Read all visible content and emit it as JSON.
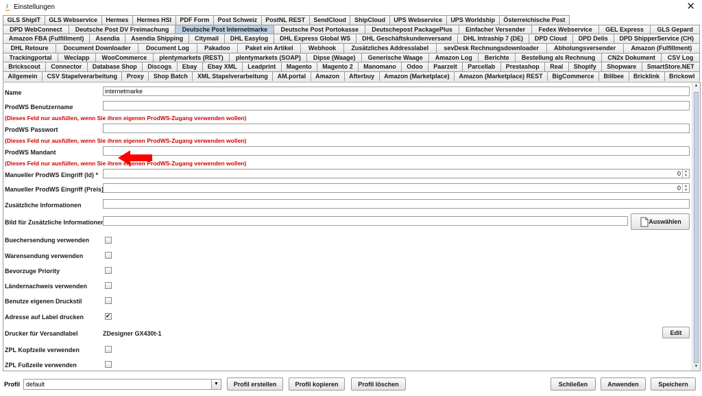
{
  "window": {
    "title": "Einstellungen",
    "close_glyph": "✕"
  },
  "tabs": {
    "row1": [
      "GLS ShipIT",
      "GLS Webservice",
      "Hermes",
      "Hermes HSI",
      "PDF Form",
      "Post Schweiz",
      "PostNL REST",
      "SendCloud",
      "ShipCloud",
      "UPS Webservice",
      "UPS Worldship",
      "Österreichische Post"
    ],
    "row2": [
      "DPD WebConnect",
      "Deutsche Post DV Freimachung",
      "Deutsche Post Internetmarke",
      "Deutsche Post Portokasse",
      "Deutschepost PackagePlus",
      "Einfacher Versender",
      "Fedex Webservice",
      "GEL Express",
      "GLS Gepard"
    ],
    "row3": [
      "Amazon FBA (Fulfillment)",
      "Asendia",
      "Asendia Shipping",
      "Citymail",
      "DHL Easylog",
      "DHL Express Global WS",
      "DHL Geschäftskundenversand",
      "DHL Intraship 7 (DE)",
      "DPD Cloud",
      "DPD Delis",
      "DPD ShipperService (CH)"
    ],
    "row4": [
      "DHL Retoure",
      "Document Downloader",
      "Document Log",
      "Pakadoo",
      "Paket ein Artikel",
      "Webhook",
      "Zusätzliches Addresslabel",
      "sevDesk Rechnungsdownloader",
      "Abholungsversender",
      "Amazon (Fulfillment)"
    ],
    "row5": [
      "Trackingportal",
      "Weclapp",
      "WooCommerce",
      "plentymarkets (REST)",
      "plentymarkets (SOAP)",
      "Dipse (Waage)",
      "Generische Waage",
      "Amazon Log",
      "Berichte",
      "Bestellung als Rechnung",
      "CN2x Dokument",
      "CSV Log"
    ],
    "row6": [
      "Brickscout",
      "Connector",
      "Database Shop",
      "Discogs",
      "Ebay",
      "Ebay XML",
      "Leadprint",
      "Magento",
      "Magento 2",
      "Manomano",
      "Odoo",
      "Paarzeit",
      "Parcellab",
      "Prestashop",
      "Real",
      "Shopify",
      "Shopware",
      "SmartStore.NET"
    ],
    "row7": [
      "Allgemein",
      "CSV Stapelverarbeitung",
      "Proxy",
      "Shop Batch",
      "XML Stapelverarbeitung",
      "AM.portal",
      "Amazon",
      "Afterbuy",
      "Amazon (Marketplace)",
      "Amazon (Marketplace) REST",
      "BigCommerce",
      "Billbee",
      "Bricklink",
      "Brickowl"
    ],
    "active": "Deutsche Post Internetmarke"
  },
  "form": {
    "name_label": "Name",
    "name_value": "internetmarke",
    "user_label": "ProdWS Benutzername",
    "user_value": "",
    "hint": "(Dieses Feld nur ausfüllen, wenn Sie ihren eigenen ProdWS-Zugang verwenden wollen)",
    "password_label": "ProdWS Passwort",
    "password_value": "",
    "mandant_label": "ProdWS Mandant",
    "mandant_value": "",
    "manual_id_label": "Manueller ProdWS Eingriff (Id) *",
    "manual_id_value": "0",
    "manual_price_label": "Manueller ProdWS Eingriff (Preis)",
    "manual_price_value": "0",
    "info_label": "Zusätzliche Informationen",
    "info_value": "",
    "image_label": "Bild für Zusätzliche Informationen",
    "image_value": "",
    "choose_button": "Auswählen",
    "buecher_label": "Buechersendung verwenden",
    "buecher_checked": false,
    "waren_label": "Warensendung verwenden",
    "waren_checked": false,
    "priority_label": "Bevorzuge Priority",
    "priority_checked": false,
    "laender_label": "Ländernachweis verwenden",
    "laender_checked": false,
    "druckstil_label": "Benutze eigenen Druckstil",
    "druckstil_checked": false,
    "adresse_label": "Adresse auf Label drucken",
    "adresse_checked": true,
    "drucker_label": "Drucker für Versandlabel",
    "drucker_value": "ZDesigner GX430t-1",
    "edit_button": "Edit",
    "zpl_kopf_label": "ZPL Kopfzeile verwenden",
    "zpl_kopf_checked": false,
    "zpl_fuss_label": "ZPL Fußzeile verwenden",
    "zpl_fuss_checked": false,
    "check_glyph": "✔"
  },
  "footer": {
    "profile_label": "Profil",
    "profile_value": "default",
    "create_button": "Profil erstellen",
    "copy_button": "Profil kopieren",
    "delete_button": "Profil löschen",
    "close_button": "Schließen",
    "apply_button": "Anwenden",
    "save_button": "Speichern"
  },
  "colors": {
    "accent_tab": "#b8cfe5",
    "hint_red": "#d00000",
    "arrow_red": "#ff0000"
  }
}
